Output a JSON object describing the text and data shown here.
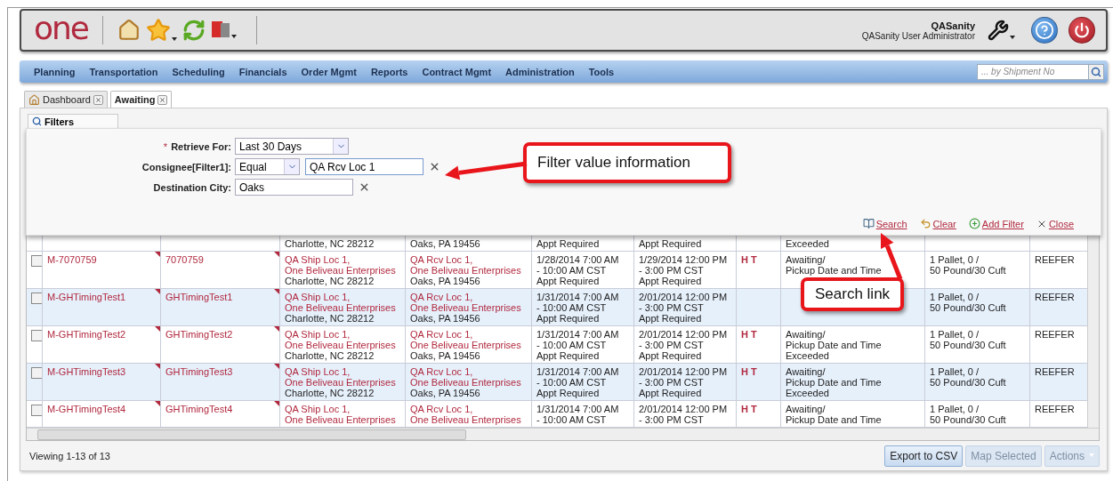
{
  "header": {
    "logo": "one",
    "user_name": "QASanity",
    "user_role": "QASanity User Administrator"
  },
  "nav": {
    "items": [
      "Planning",
      "Transportation",
      "Scheduling",
      "Financials",
      "Order Mgmt",
      "Reports",
      "Contract Mgmt",
      "Administration",
      "Tools"
    ],
    "search": {
      "placeholder": "... by Shipment No"
    }
  },
  "tabs": [
    {
      "label": "Dashboard",
      "kind": "home",
      "selected": false
    },
    {
      "label": "Awaiting",
      "kind": "plain",
      "selected": true
    }
  ],
  "filters": {
    "tab_label": "Filters",
    "fields": [
      {
        "kind": "select",
        "required_mark": "*",
        "label": "Retrieve For:",
        "value": "Last 30 Days"
      },
      {
        "kind": "operator",
        "label": "Consignee[Filter1]:",
        "operator": "Equal",
        "value": "QA Rcv Loc 1"
      },
      {
        "kind": "text",
        "label": "Destination City:",
        "value": "Oaks"
      }
    ],
    "actions": [
      {
        "kind": "search",
        "label": "Search"
      },
      {
        "kind": "clear",
        "label": "Clear"
      },
      {
        "kind": "add",
        "label": "Add Filter"
      },
      {
        "kind": "close",
        "label": "Close"
      }
    ]
  },
  "grid": {
    "tail_row": {
      "origin": "Charlotte, NC 28212",
      "destination": "Oaks, PA 19456",
      "pickup": "Appt Required",
      "delivery": "Appt Required",
      "status": "Exceeded"
    },
    "rows": [
      {
        "checked": false,
        "order": "M-7070759",
        "reference": "7070759",
        "origin": {
          "name": "QA Ship Loc 1,",
          "company": "One Beliveau Enterprises",
          "city": "Charlotte, NC 28212"
        },
        "destination": {
          "name": "QA Rcv Loc 1,",
          "company": "One Beliveau Enterprises",
          "city": "Oaks, PA 19456"
        },
        "pickup": [
          "1/28/2014 7:00 AM",
          "- 10:00 AM CST",
          "Appt Required"
        ],
        "delivery": [
          "1/29/2014 12:00 PM",
          "- 3:00 PM CST",
          "Appt Required"
        ],
        "flags": "H T",
        "status": [
          "Awaiting/",
          "Pickup Date and Time"
        ],
        "load": [
          "1 Pallet, 0 /",
          "50 Pound/30 Cuft"
        ],
        "equipment": "REEFER"
      },
      {
        "checked": false,
        "order": "M-GHTimingTest1",
        "reference": "GHTimingTest1",
        "origin": {
          "name": "QA Ship Loc 1,",
          "company": "One Beliveau Enterprises",
          "city": "Charlotte, NC 28212"
        },
        "destination": {
          "name": "QA Rcv Loc 1,",
          "company": "One Beliveau Enterprises",
          "city": "Oaks, PA 19456"
        },
        "pickup": [
          "1/31/2014 7:00 AM",
          "- 10:00 AM CST",
          "Appt Required"
        ],
        "delivery": [
          "2/01/2014 12:00 PM",
          "- 3:00 PM CST",
          "Appt Required"
        ],
        "load": [
          "1 Pallet, 0 /",
          "50 Pound/30 Cuft"
        ],
        "equipment": "REEFER"
      },
      {
        "checked": false,
        "order": "M-GHTimingTest2",
        "reference": "GHTimingTest2",
        "origin": {
          "name": "QA Ship Loc 1,",
          "company": "One Beliveau Enterprises",
          "city": "Charlotte, NC 28212"
        },
        "destination": {
          "name": "QA Rcv Loc 1,",
          "company": "One Beliveau Enterprises",
          "city": "Oaks, PA 19456"
        },
        "pickup": [
          "1/31/2014 7:00 AM",
          "- 10:00 AM CST",
          "Appt Required"
        ],
        "delivery": [
          "2/01/2014 12:00 PM",
          "- 3:00 PM CST",
          "Appt Required"
        ],
        "flags": "H T",
        "status": [
          "Awaiting/",
          "Pickup Date and Time",
          "Exceeded"
        ],
        "load": [
          "1 Pallet, 0 /",
          "50 Pound/30 Cuft"
        ],
        "equipment": "REEFER"
      },
      {
        "checked": false,
        "order": "M-GHTimingTest3",
        "reference": "GHTimingTest3",
        "origin": {
          "name": "QA Ship Loc 1,",
          "company": "One Beliveau Enterprises",
          "city": "Charlotte, NC 28212"
        },
        "destination": {
          "name": "QA Rcv Loc 1,",
          "company": "One Beliveau Enterprises",
          "city": "Oaks, PA 19456"
        },
        "pickup": [
          "1/31/2014 7:00 AM",
          "- 10:00 AM CST",
          "Appt Required"
        ],
        "delivery": [
          "2/01/2014 12:00 PM",
          "- 3:00 PM CST",
          "Appt Required"
        ],
        "flags": "H T",
        "status": [
          "Awaiting/",
          "Pickup Date and Time",
          "Exceeded"
        ],
        "load": [
          "1 Pallet, 0 /",
          "50 Pound/30 Cuft"
        ],
        "equipment": "REEFER"
      },
      {
        "checked": false,
        "order": "M-GHTimingTest4",
        "reference": "GHTimingTest4",
        "origin": {
          "name": "QA Ship Loc 1,",
          "company": "One Beliveau Enterprises"
        },
        "destination": {
          "name": "QA Rcv Loc 1,",
          "company": "One Beliveau Enterprises"
        },
        "pickup": [
          "1/31/2014 7:00 AM",
          "- 10:00 AM CST"
        ],
        "delivery": [
          "2/01/2014 12:00 PM",
          "- 3:00 PM CST"
        ],
        "flags": "H T",
        "status": [
          "Awaiting/",
          "Pickup Date and Time"
        ],
        "load": [
          "1 Pallet, 0 /",
          "50 Pound/30 Cuft"
        ],
        "equipment": "REEFER"
      }
    ]
  },
  "footer": {
    "summary": "Viewing 1-13 of 13",
    "buttons": [
      {
        "kind": "plain",
        "label": "Export to CSV",
        "disabled": false
      },
      {
        "kind": "plain",
        "label": "Map Selected",
        "disabled": true
      },
      {
        "kind": "menu",
        "label": "Actions",
        "disabled": true
      }
    ]
  },
  "annotations": [
    {
      "kind": "callout",
      "text": "Filter value information"
    },
    {
      "kind": "callout",
      "text": "Search link"
    }
  ]
}
